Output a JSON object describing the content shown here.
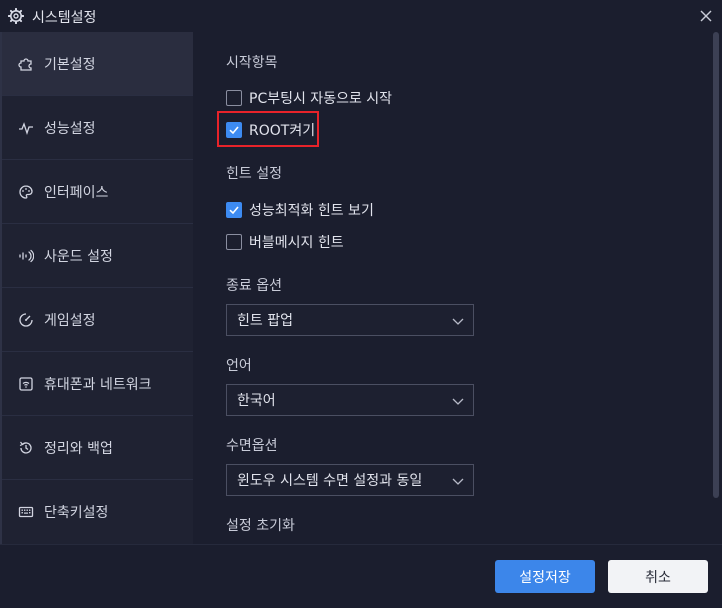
{
  "window": {
    "title": "시스템설정"
  },
  "sidebar": {
    "items": [
      {
        "label": "기본설정",
        "icon": "puzzle-icon",
        "active": true
      },
      {
        "label": "성능설정",
        "icon": "pulse-icon",
        "active": false
      },
      {
        "label": "인터페이스",
        "icon": "palette-icon",
        "active": false
      },
      {
        "label": "사운드 설정",
        "icon": "sound-wave-icon",
        "active": false
      },
      {
        "label": "게임설정",
        "icon": "game-dial-icon",
        "active": false
      },
      {
        "label": "휴대폰과 네트워크",
        "icon": "wifi-box-icon",
        "active": false
      },
      {
        "label": "정리와 백업",
        "icon": "history-icon",
        "active": false
      },
      {
        "label": "단축키설정",
        "icon": "keyboard-icon",
        "active": false
      }
    ]
  },
  "main": {
    "startup": {
      "title": "시작항목",
      "options": [
        {
          "label": "PC부팅시 자동으로 시작",
          "checked": false
        },
        {
          "label": "ROOT켜기",
          "checked": true
        }
      ]
    },
    "hints": {
      "title": "힌트 설정",
      "options": [
        {
          "label": "성능최적화 힌트 보기",
          "checked": true
        },
        {
          "label": "버블메시지 힌트",
          "checked": false
        }
      ]
    },
    "exit_option": {
      "title": "종료 옵션",
      "value": "힌트 팝업"
    },
    "language": {
      "title": "언어",
      "value": "한국어"
    },
    "sleep_option": {
      "title": "수면옵션",
      "value": "윈도우 시스템 수면 설정과 동일"
    },
    "reset": {
      "title": "설정 초기화"
    }
  },
  "footer": {
    "save_label": "설정저장",
    "cancel_label": "취소"
  },
  "colors": {
    "accent": "#3c86ea",
    "highlight": "#e8232a",
    "background": "#1b1e2e"
  }
}
